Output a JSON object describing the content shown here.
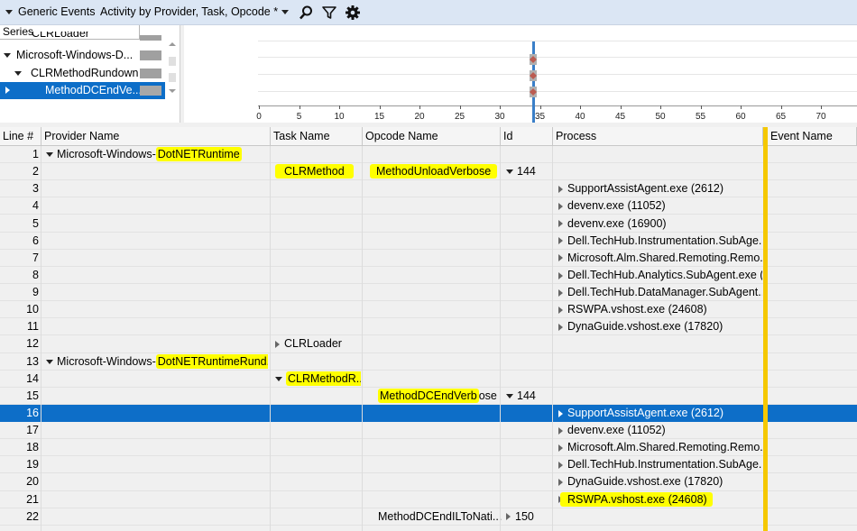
{
  "header": {
    "panel_title": "Generic Events",
    "view_name": "Activity by Provider, Task, Opcode *",
    "tools": [
      "search-icon",
      "filter-icon",
      "gear-icon"
    ]
  },
  "series": {
    "header": "Series",
    "items": [
      {
        "label": "CLRLoader",
        "expander": "none",
        "indent": 1,
        "selected": false,
        "partial": true
      },
      {
        "label": "Microsoft-Windows-D...",
        "expander": "down",
        "indent": 0,
        "selected": false
      },
      {
        "label": "CLRMethodRundown",
        "expander": "down",
        "indent": 1,
        "selected": false
      },
      {
        "label": "MethodDCEndVe...",
        "expander": "right",
        "indent": 2,
        "selected": true
      }
    ]
  },
  "timeline": {
    "ticks": [
      "0",
      "5",
      "10",
      "15",
      "20",
      "25",
      "30",
      "35",
      "40",
      "45",
      "50",
      "55",
      "60",
      "65",
      "70"
    ],
    "marker_at": 34.2
  },
  "table": {
    "columns": [
      {
        "key": "line",
        "label": "Line #"
      },
      {
        "key": "provider",
        "label": "Provider Name"
      },
      {
        "key": "task",
        "label": "Task Name"
      },
      {
        "key": "opcode",
        "label": "Opcode Name"
      },
      {
        "key": "id",
        "label": "Id"
      },
      {
        "key": "process",
        "label": "Process"
      },
      {
        "key": "event",
        "label": "Event Name"
      }
    ],
    "rows": [
      {
        "line": "1",
        "provider_prefix": "Microsoft-Windows-",
        "provider_hl": "DotNETRuntime",
        "provider_exp": "down"
      },
      {
        "line": "2",
        "task": "CLRMethod",
        "task_hl": true,
        "opcode": "MethodUnloadVerbose",
        "opcode_hl": true,
        "id": "144",
        "id_exp": "down"
      },
      {
        "line": "3",
        "process": "SupportAssistAgent.exe (2612)"
      },
      {
        "line": "4",
        "process": "devenv.exe (11052)"
      },
      {
        "line": "5",
        "process": "devenv.exe (16900)"
      },
      {
        "line": "6",
        "process": "Dell.TechHub.Instrumentation.SubAge..."
      },
      {
        "line": "7",
        "process": "Microsoft.Alm.Shared.Remoting.Remo..."
      },
      {
        "line": "8",
        "process": "Dell.TechHub.Analytics.SubAgent.exe (..."
      },
      {
        "line": "9",
        "process": "Dell.TechHub.DataManager.SubAgent...."
      },
      {
        "line": "10",
        "process": "RSWPA.vshost.exe (24608)"
      },
      {
        "line": "11",
        "process": "DynaGuide.vshost.exe (17820)"
      },
      {
        "line": "12",
        "task": "CLRLoader",
        "task_exp": "right"
      },
      {
        "line": "13",
        "provider_prefix": "Microsoft-Windows-",
        "provider_hl": "DotNETRuntimeRund...",
        "provider_exp": "down"
      },
      {
        "line": "14",
        "task": "CLRMethodR...",
        "task_hl": true,
        "task_exp": "down"
      },
      {
        "line": "15",
        "opcode": "MethodDCEndVerbose",
        "opcode_hl_part": "MethodDCEndVerb",
        "opcode_rest": "ose",
        "id": "144",
        "id_exp": "down"
      },
      {
        "line": "16",
        "process": "SupportAssistAgent.exe (2612)",
        "selected": true
      },
      {
        "line": "17",
        "process": "devenv.exe (11052)"
      },
      {
        "line": "18",
        "process": "Microsoft.Alm.Shared.Remoting.Remo..."
      },
      {
        "line": "19",
        "process": "Dell.TechHub.Instrumentation.SubAge..."
      },
      {
        "line": "20",
        "process": "DynaGuide.vshost.exe (17820)"
      },
      {
        "line": "21",
        "process": "RSWPA.vshost.exe (24608)",
        "process_hl": true
      },
      {
        "line": "22",
        "opcode": "MethodDCEndILToNati...",
        "id": "150",
        "id_exp": "right"
      }
    ]
  }
}
